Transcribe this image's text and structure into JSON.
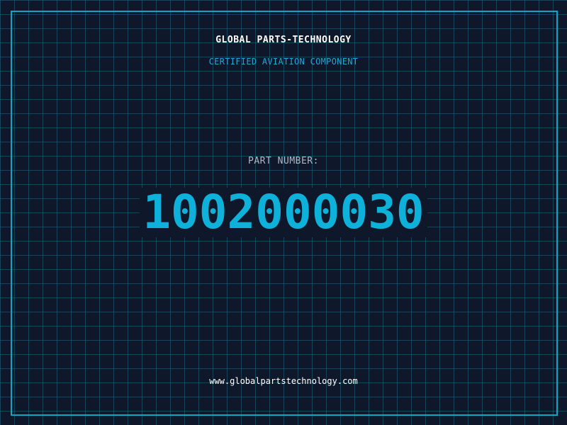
{
  "header": {
    "company_name": "GLOBAL PARTS-TECHNOLOGY",
    "tagline": "CERTIFIED AVIATION COMPONENT"
  },
  "part": {
    "label": "PART NUMBER:",
    "number": "1002000030"
  },
  "footer": {
    "website": "www.globalpartstechnology.com"
  },
  "colors": {
    "background": "#0f172a",
    "grid": "#227896",
    "border": "#0ea5c9",
    "accent": "#0eb1da",
    "text": "#ffffff",
    "muted": "#aeb8c6"
  }
}
